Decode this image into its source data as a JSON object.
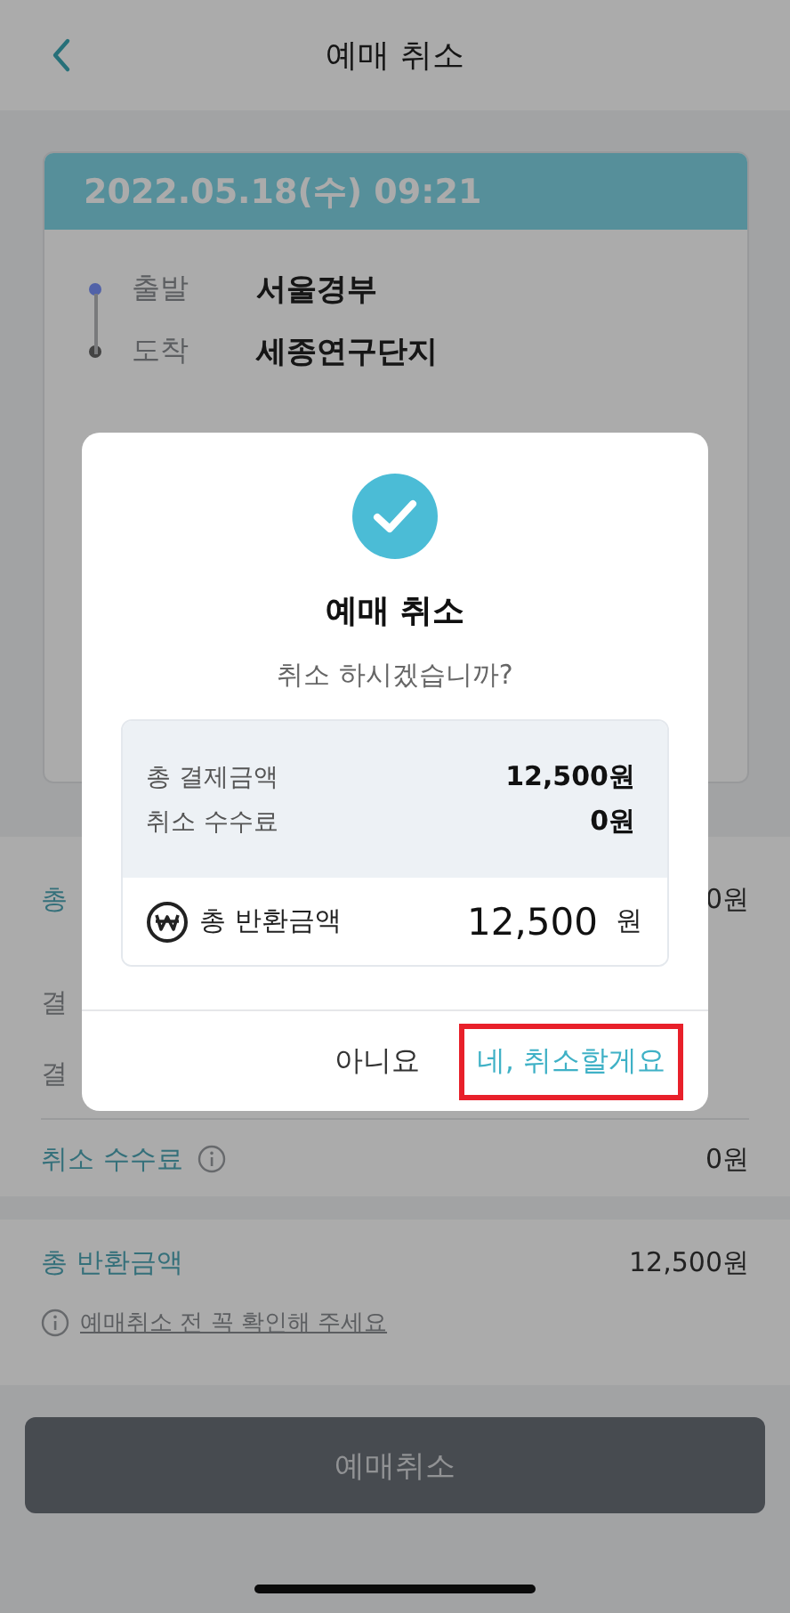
{
  "header": {
    "title": "예매 취소"
  },
  "ticket": {
    "date": "2022.05.18(수) 09:21",
    "route": [
      {
        "label": "출발",
        "place": "서울경부",
        "color": "#5262a8"
      },
      {
        "label": "도착",
        "place": "세종연구단지",
        "color": "#444444"
      }
    ]
  },
  "details": {
    "partial_rows": [
      {
        "label": "총",
        "value": "0원"
      },
      {
        "label": "결"
      },
      {
        "label": "결"
      }
    ],
    "fee": {
      "label": "취소 수수료",
      "value": "0원"
    },
    "refund": {
      "label": "총 반환금액",
      "value": "12,500원"
    },
    "notice": "예매취소 전 꼭 확인해 주세요"
  },
  "cancel_button": {
    "label": "예매취소",
    "disabled": true
  },
  "dialog": {
    "title": "예매 취소",
    "message": "취소 하시겠습니까?",
    "summary": [
      {
        "label": "총 결제금액",
        "value": "12,500원"
      },
      {
        "label": "취소 수수료",
        "value": "0원"
      }
    ],
    "total": {
      "label": "총 반환금액",
      "amount": "12,500",
      "unit": "원"
    },
    "buttons": [
      {
        "label": "아니요",
        "kind": "secondary",
        "highlighted": false
      },
      {
        "label": "네, 취소할게요",
        "kind": "primary",
        "highlighted": true
      }
    ]
  }
}
